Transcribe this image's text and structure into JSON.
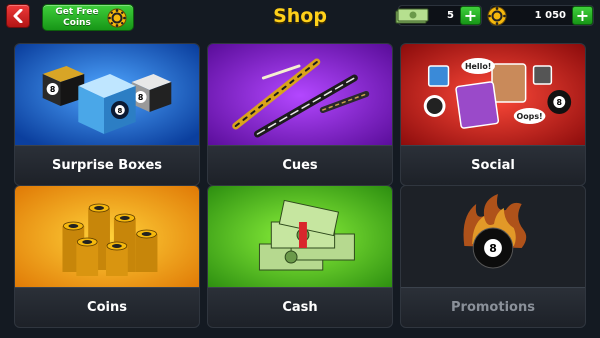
{
  "header": {
    "title": "Shop",
    "free_coins_label": "Get Free Coins",
    "cash_amount": "5",
    "coins_amount": "1 050",
    "plus": "+"
  },
  "tiles": [
    {
      "label": "Surprise Boxes",
      "accent": "#1a6fd6"
    },
    {
      "label": "Cues",
      "accent": "#8a1fd0"
    },
    {
      "label": "Social",
      "accent": "#d21c1c"
    },
    {
      "label": "Coins",
      "accent": "#f5a60e"
    },
    {
      "label": "Cash",
      "accent": "#43b81b"
    },
    {
      "label": "Promotions",
      "accent": "#22262c",
      "disabled": true
    }
  ],
  "social_bubbles": {
    "hello": "Hello!",
    "oops": "Oops!"
  },
  "ball_number": "8",
  "colors": {
    "title": "#ffd11a",
    "back_button": "#d62626",
    "plus_button": "#2fb52b"
  }
}
